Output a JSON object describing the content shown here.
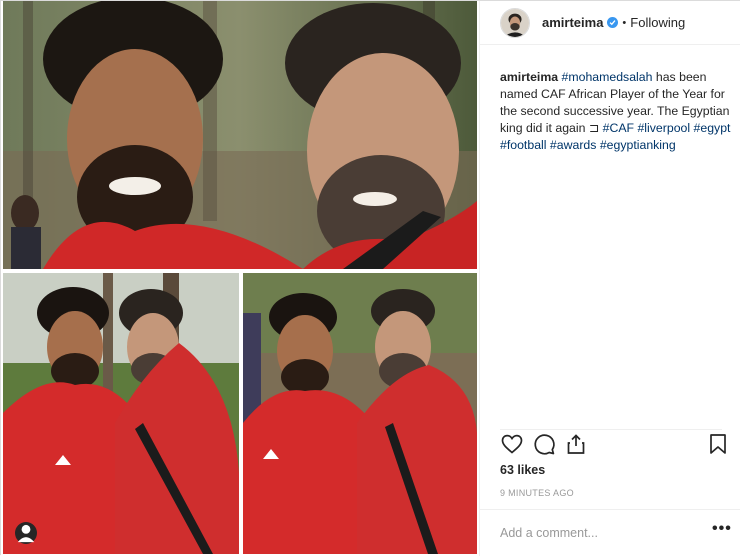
{
  "post": {
    "username": "amirteima",
    "separator": "•",
    "follow_status": "Following",
    "caption": {
      "username": "amirteima",
      "part1_tag": "#mohamedsalah",
      "part2_text": " has been named CAF African Player of the Year for the second successive year. The Egyptian king did it again ",
      "glyph": "⊐",
      "tags": [
        "#CAF",
        "#liverpool",
        "#egypt",
        "#football",
        "#awards",
        "#egyptianking"
      ]
    },
    "likes": "63 likes",
    "time": "9 MINUTES AGO",
    "comment_placeholder": "Add a comment...",
    "more_label": "•••"
  },
  "icons": {
    "verified": "verified-badge-icon",
    "like": "heart-icon",
    "comment": "comment-icon",
    "share": "share-icon",
    "save": "bookmark-icon",
    "tag": "user-tag-icon"
  },
  "colors": {
    "hashtag": "#003569",
    "verified": "#3897f0",
    "muted": "#999999",
    "jersey_red": "#d32a2a"
  }
}
